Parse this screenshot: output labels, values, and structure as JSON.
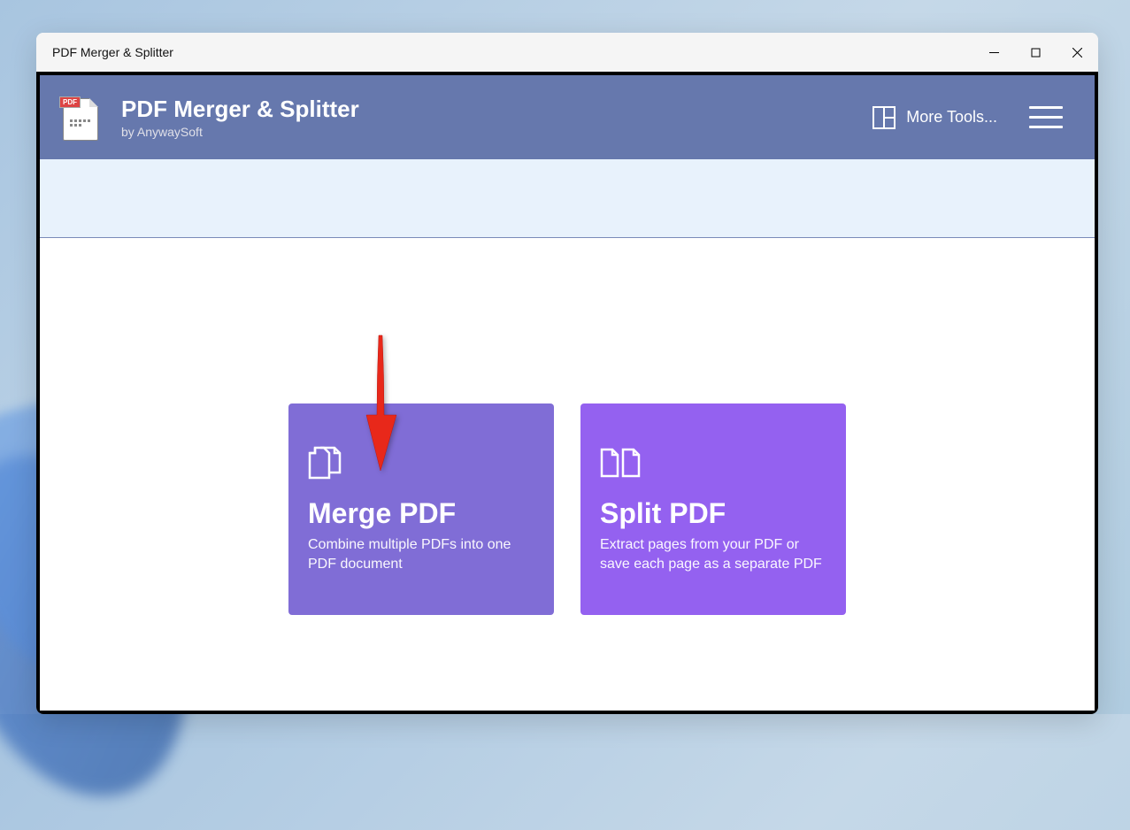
{
  "window": {
    "title": "PDF Merger & Splitter"
  },
  "header": {
    "app_title": "PDF Merger & Splitter",
    "app_subtitle": "by AnywaySoft",
    "more_tools_label": "More Tools...",
    "logo_badge": "PDF"
  },
  "cards": {
    "merge": {
      "title": "Merge PDF",
      "description": "Combine multiple PDFs into one PDF document"
    },
    "split": {
      "title": "Split PDF",
      "description": "Extract pages from your PDF or save each page as a separate PDF"
    }
  }
}
